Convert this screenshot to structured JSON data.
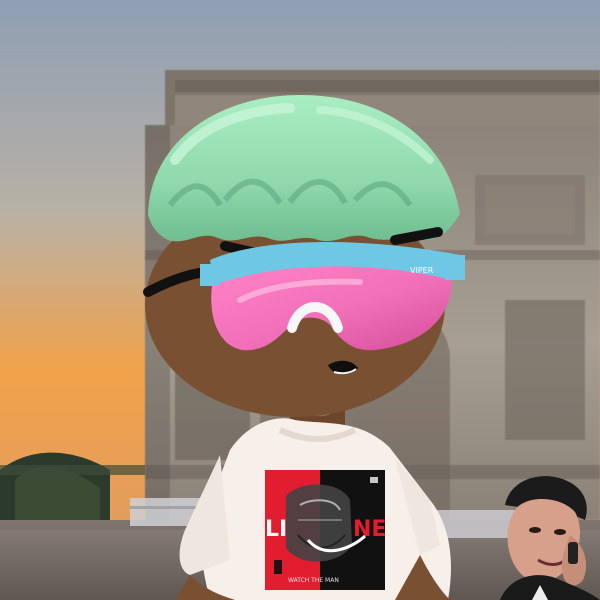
{
  "image": {
    "scene": "avatar-in-front-of-arch",
    "colors": {
      "sky_top": "#9aa7b8",
      "sky_mid": "#c9a27a",
      "sky_glow": "#f2a24a",
      "arch_stone": "#a49a8e",
      "arch_shadow": "#5d5650",
      "hair": "#8fd9ad",
      "hair_shadow": "#5aa47d",
      "skin": "#7a5032",
      "goggle_lens": "#f06fb8",
      "goggle_frame": "#6fc7e6",
      "shirt": "#f7efe9",
      "print_red": "#e11d2f",
      "print_black": "#111111"
    }
  },
  "tshirt_print": {
    "left_text": "LI",
    "right_text": "NE",
    "tiny_caption": "WATCH THE MAN"
  },
  "goggle_brand": "VIPER"
}
